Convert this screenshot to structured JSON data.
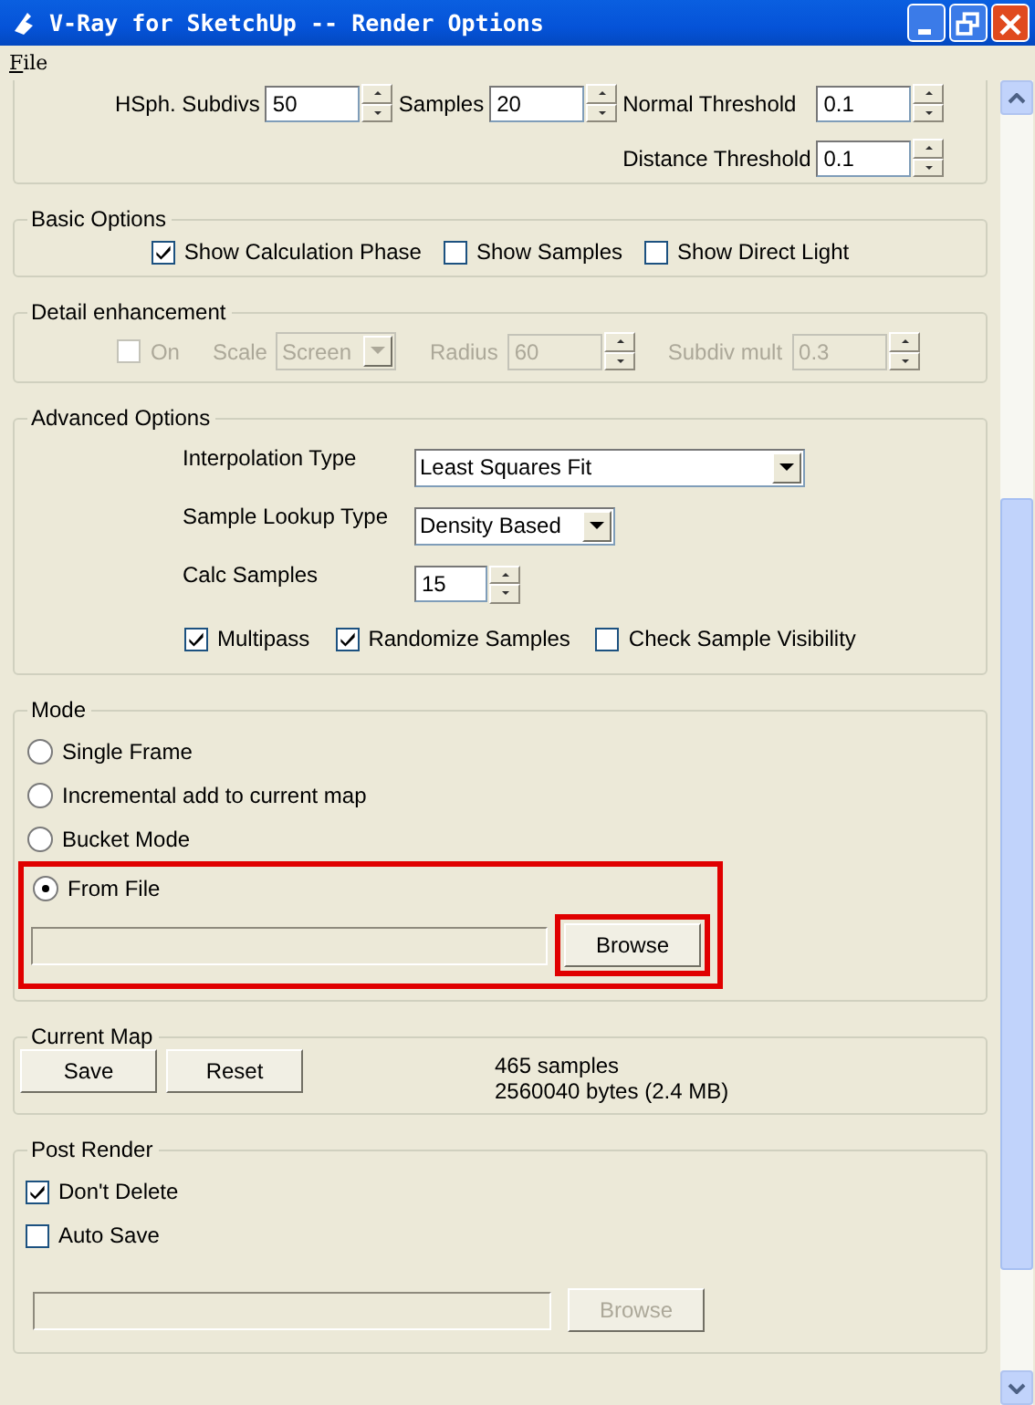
{
  "window": {
    "title": "V-Ray for SketchUp -- Render Options"
  },
  "menu": [
    {
      "label": "File"
    }
  ],
  "top_section": {
    "rows": [
      [
        {
          "label": "HSph. Subdivs",
          "value": "50"
        },
        {
          "label": "Samples",
          "value": "20"
        },
        {
          "label": "Normal Threshold",
          "value": "0.1"
        }
      ],
      [
        null,
        null,
        {
          "label": "Distance Threshold",
          "value": "0.1"
        }
      ]
    ]
  },
  "basic_options": {
    "title": "Basic Options",
    "checkboxes": [
      {
        "label": "Show Calculation Phase",
        "checked": true
      },
      {
        "label": "Show Samples",
        "checked": false
      },
      {
        "label": "Show Direct Light",
        "checked": false
      }
    ]
  },
  "detail_enhancement": {
    "title": "Detail enhancement",
    "disabled": true,
    "controls": [
      {
        "kind": "checkbox",
        "label": "On",
        "checked": false
      },
      {
        "kind": "dropdown",
        "label": "Scale",
        "value": "Screen"
      },
      {
        "kind": "spinner",
        "label": "Radius",
        "value": "60"
      },
      {
        "kind": "spinner",
        "label": "Subdiv mult",
        "value": "0.3"
      }
    ]
  },
  "advanced_options": {
    "title": "Advanced Options",
    "rows": [
      {
        "kind": "dropdown",
        "label": "Interpolation Type",
        "value": "Least Squares Fit",
        "wide": true
      },
      {
        "kind": "dropdown",
        "label": "Sample Lookup Type",
        "value": "Density Based",
        "wide": false
      },
      {
        "kind": "spinner",
        "label": "Calc Samples",
        "value": "15"
      }
    ],
    "checkboxes": [
      {
        "label": "Multipass",
        "checked": true
      },
      {
        "label": "Randomize Samples",
        "checked": true
      },
      {
        "label": "Check Sample Visibility",
        "checked": false
      }
    ]
  },
  "mode": {
    "title": "Mode",
    "options": [
      {
        "label": "Single Frame",
        "selected": false
      },
      {
        "label": "Incremental add to current map",
        "selected": false
      },
      {
        "label": "Bucket Mode",
        "selected": false
      }
    ],
    "file": {
      "highlighted": true,
      "option": {
        "label": "From File",
        "selected": true
      },
      "button": {
        "label": "Browse",
        "highlighted": true,
        "disabled": false
      }
    }
  },
  "current_map": {
    "title": "Current Map",
    "buttons": [
      "Save",
      "Reset"
    ],
    "info": [
      "465 samples",
      "2560040 bytes (2.4 MB)"
    ]
  },
  "post_render": {
    "title": "Post Render",
    "checkboxes": [
      {
        "label": "Don't Delete",
        "checked": true
      },
      {
        "label": "Auto Save",
        "checked": false
      }
    ],
    "button": {
      "label": "Browse",
      "disabled": true
    }
  }
}
